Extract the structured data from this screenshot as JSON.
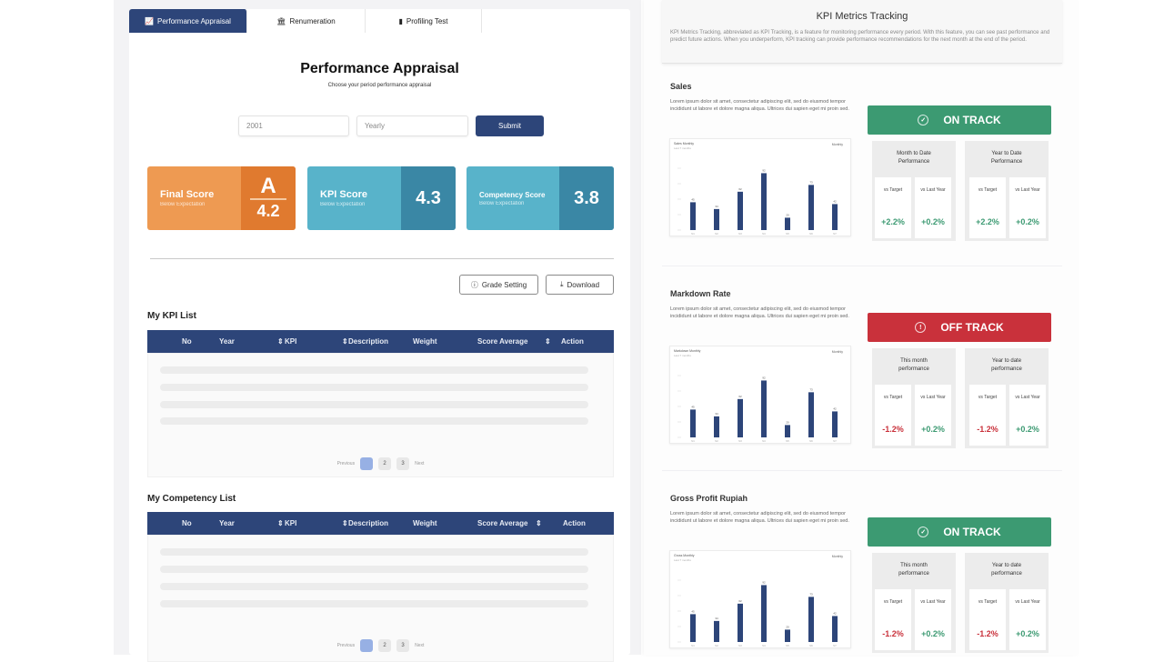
{
  "tabs": [
    {
      "label": "Performance Appraisal",
      "icon": "chart-icon",
      "active": true
    },
    {
      "label": "Renumeration",
      "icon": "building-icon",
      "active": false
    },
    {
      "label": "Profiling Test",
      "icon": "document-icon",
      "active": false
    }
  ],
  "appraisal": {
    "title": "Performance Appraisal",
    "subtitle": "Choose your period performance appraisal",
    "year_value": "2001",
    "period_value": "Yearly",
    "submit_label": "Submit"
  },
  "scores": {
    "final": {
      "label": "Final Score",
      "sub": "Below Expectation",
      "grade": "A",
      "value": "4.2"
    },
    "kpi": {
      "label": "KPI Score",
      "sub": "Below Expectation",
      "value": "4.3"
    },
    "competency": {
      "label": "Competency Score",
      "sub": "Below Expectation",
      "value": "3.8"
    }
  },
  "actions": {
    "grade_setting": "Grade Setting",
    "download": "Download"
  },
  "kpi_list": {
    "title": "My KPI List",
    "columns": [
      "No",
      "Year",
      "KPI",
      "Description",
      "Weight",
      "Score Average",
      "Action"
    ],
    "pagination": {
      "prev": "Previous",
      "pages": [
        "1",
        "2",
        "3"
      ],
      "next": "Next",
      "current": "1"
    }
  },
  "competency_list": {
    "title": "My Competency List",
    "columns": [
      "No",
      "Year",
      "KPI",
      "Description",
      "Weight",
      "Score Average",
      "Action"
    ],
    "pagination": {
      "prev": "Previous",
      "pages": [
        "1",
        "2",
        "3"
      ],
      "next": "Next",
      "current": "1"
    }
  },
  "tracking": {
    "title": "KPI Metrics Tracking",
    "description": "KPI Metrics Tracking, abbreviated as KPI Tracking, is a feature for monitoring performance every period. With this feature, you can see past performance and predict future actions. When you underperform, KPI tracking can provide performance recommendations for the next month at the end of the period.",
    "metrics": [
      {
        "name": "Sales",
        "description": "Lorem ipsum dolor sit amet, consectetur adipiscing elit, sed do eiusmod tempor incididunt ut labore et dolore magna aliqua. Ultrices dui sapien eget mi proin sed.",
        "chart_title": "Sales Monthly",
        "chart_subtitle": "Last 7 months",
        "chart_filter": "Monthly",
        "status": "ON TRACK",
        "status_type": "on",
        "period_a": "Month to Date Performance",
        "period_b": "Year to Date Performance",
        "vs_target_label": "vs Target",
        "vs_last_year_label": "vs Last Year",
        "a_vs_target": "+2.2%",
        "a_vs_last_year": "+0.2%",
        "b_vs_target": "+2.2%",
        "b_vs_last_year": "+0.2%"
      },
      {
        "name": "Markdown Rate",
        "description": "Lorem ipsum dolor sit amet, consectetur adipiscing elit, sed do eiusmod tempor incididunt ut labore et dolore magna aliqua. Ultrices dui sapien eget mi proin sed.",
        "chart_title": "Markdown Monthly",
        "chart_subtitle": "Last 7 months",
        "chart_filter": "Monthly",
        "status": "OFF TRACK",
        "status_type": "off",
        "period_a": "This month performance",
        "period_b": "Year to date performance",
        "vs_target_label": "vs Target",
        "vs_last_year_label": "vs Last Year",
        "a_vs_target": "-1.2%",
        "a_vs_last_year": "+0.2%",
        "b_vs_target": "-1.2%",
        "b_vs_last_year": "+0.2%"
      },
      {
        "name": "Gross Profit Rupiah",
        "description": "Lorem ipsum dolor sit amet, consectetur adipiscing elit, sed do eiusmod tempor incididunt ut labore et dolore magna aliqua. Ultrices dui sapien eget mi proin sed.",
        "chart_title": "Gross Monthly",
        "chart_subtitle": "Last 7 months",
        "chart_filter": "Monthly",
        "status": "ON TRACK",
        "status_type": "on",
        "period_a": "This month performance",
        "period_b": "Year to date performance",
        "vs_target_label": "vs Target",
        "vs_last_year_label": "vs Last Year",
        "a_vs_target": "-1.2%",
        "a_vs_last_year": "+0.2%",
        "b_vs_target": "-1.2%",
        "b_vs_last_year": "+0.2%"
      }
    ]
  },
  "chart_data": [
    {
      "type": "bar",
      "title": "Sales Monthly",
      "categories": [
        "M1",
        "M2",
        "M3",
        "M4",
        "M5",
        "M6",
        "M7"
      ],
      "values": [
        45,
        34,
        62,
        92,
        20,
        73,
        42
      ],
      "ylim": [
        0,
        100
      ],
      "grid": false
    },
    {
      "type": "bar",
      "title": "Markdown Monthly",
      "categories": [
        "M1",
        "M2",
        "M3",
        "M4",
        "M5",
        "M6",
        "M7"
      ],
      "values": [
        45,
        34,
        62,
        92,
        20,
        73,
        42
      ],
      "ylim": [
        0,
        100
      ],
      "grid": false
    },
    {
      "type": "bar",
      "title": "Gross Monthly",
      "categories": [
        "M1",
        "M2",
        "M3",
        "M4",
        "M5",
        "M6",
        "M7"
      ],
      "values": [
        45,
        34,
        62,
        92,
        20,
        73,
        42
      ],
      "ylim": [
        0,
        100
      ],
      "grid": false
    }
  ],
  "colors": {
    "primary": "#2d4579",
    "on_track": "#3c9a72",
    "off_track": "#c9313b",
    "final_score": "#ee9a52",
    "kpi_score": "#58b3ca"
  }
}
